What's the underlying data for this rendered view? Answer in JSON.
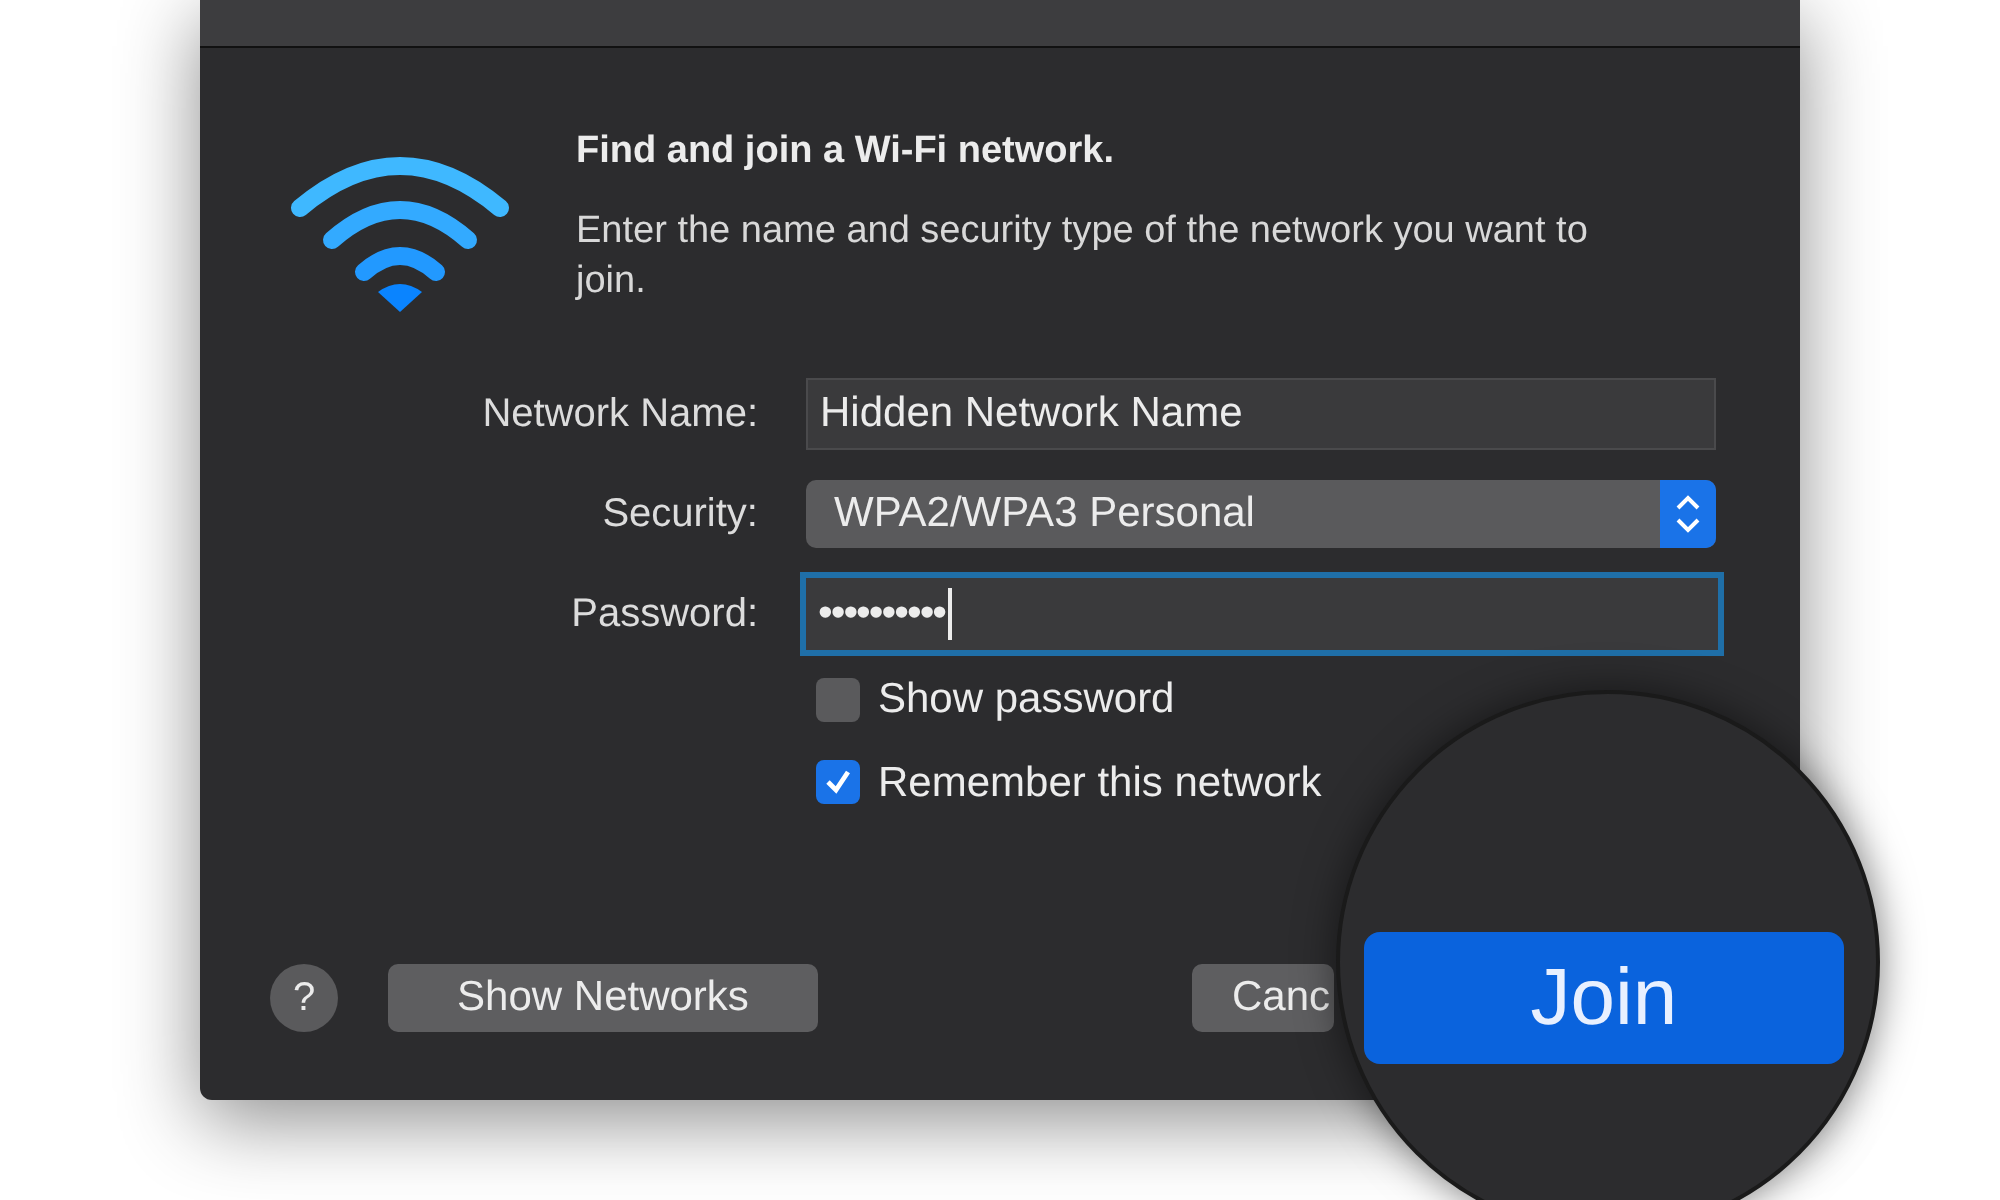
{
  "dialog": {
    "heading": "Find and join a Wi-Fi network.",
    "message": "Enter the name and security type of the network you want to join.",
    "fields": [
      {
        "kind": "text",
        "label": "Network Name:",
        "value": "Hidden Network Name",
        "focused": false
      },
      {
        "kind": "select",
        "label": "Security:",
        "value": "WPA2/WPA3 Personal",
        "focused": false
      },
      {
        "kind": "password",
        "label": "Password:",
        "value": "••••••••••",
        "focused": true
      }
    ],
    "checkboxes": [
      {
        "label": "Show password",
        "checked": false
      },
      {
        "label": "Remember this network",
        "checked": true
      }
    ],
    "help": "?",
    "buttons": [
      {
        "kind": "secondary",
        "label": "Show Networks"
      },
      {
        "kind": "cancel",
        "label": "Canc"
      }
    ]
  },
  "magnifier": {
    "button": "Join"
  }
}
